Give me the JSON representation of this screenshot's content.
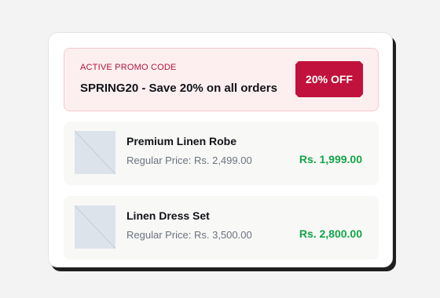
{
  "promo": {
    "label": "ACTIVE PROMO CODE",
    "text": "SPRING20 - Save 20% on all orders",
    "badge": "20% OFF"
  },
  "products": [
    {
      "name": "Premium Linen Robe",
      "regular_price": "Regular Price: Rs. 2,499.00",
      "sale_price": "Rs. 1,999.00"
    },
    {
      "name": "Linen Dress Set",
      "regular_price": "Regular Price: Rs. 3,500.00",
      "sale_price": "Rs. 2,800.00"
    }
  ],
  "colors": {
    "accent": "#c0123c",
    "sale": "#15a34a",
    "promo_background": "#fdeff0"
  },
  "icons": {
    "thumbnail": "image-placeholder-icon"
  }
}
